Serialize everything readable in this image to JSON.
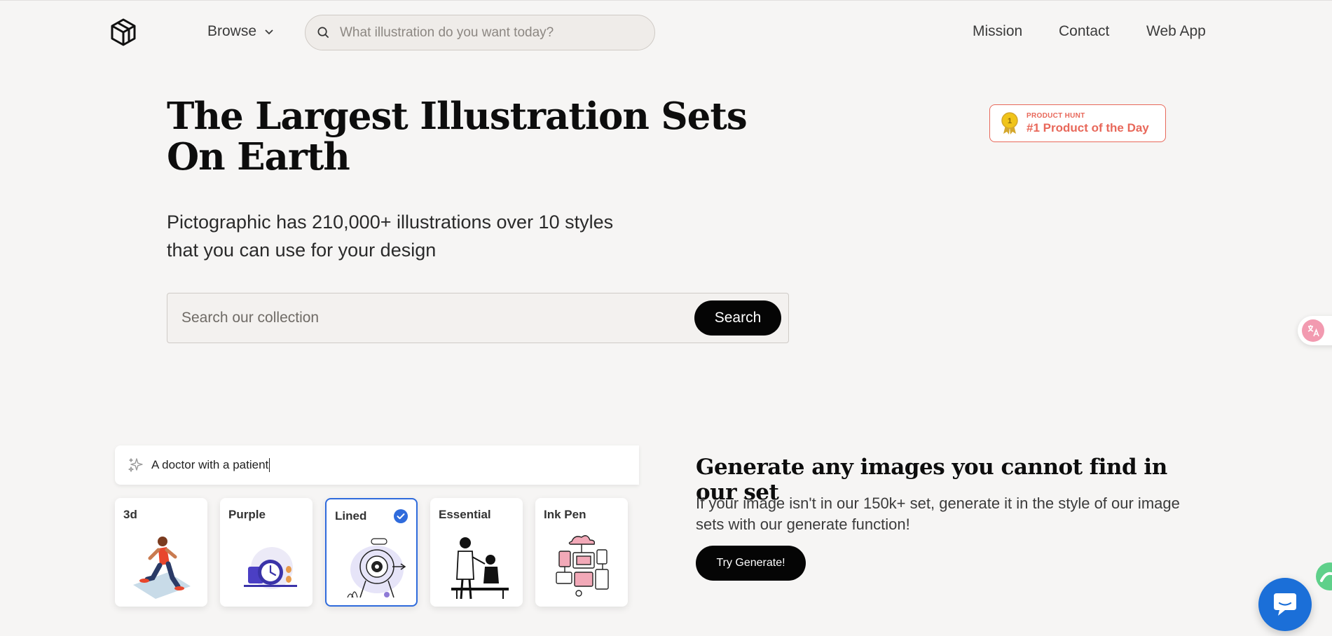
{
  "header": {
    "browse_label": "Browse",
    "search_placeholder": "What illustration do you want today?",
    "nav": [
      "Mission",
      "Contact",
      "Web App"
    ]
  },
  "hero": {
    "title": "The Largest Illustration Sets On Earth",
    "subtitle_line1": "Pictographic has 210,000+ illustrations over 10 styles",
    "subtitle_line2": "that you can use for your design",
    "search_placeholder": "Search our collection",
    "search_button": "Search"
  },
  "product_hunt": {
    "small_label": "PRODUCT HUNT",
    "title": "#1 Product of the Day",
    "medal_number": "1",
    "color": "#e8685a"
  },
  "generator": {
    "prompt": "A doctor with a patient",
    "styles": [
      {
        "label": "3d",
        "selected": false
      },
      {
        "label": "Purple",
        "selected": false
      },
      {
        "label": "Lined",
        "selected": true
      },
      {
        "label": "Essential",
        "selected": false
      },
      {
        "label": "Ink Pen",
        "selected": false
      }
    ],
    "title": "Generate any images you cannot find in our set",
    "description": "If your image isn't in our 150k+ set, generate it in the style of our image sets with our generate function!",
    "button": "Try Generate!"
  },
  "icons": {
    "logo": "cube-logo-icon",
    "search": "search-icon",
    "chevron": "chevron-down-icon",
    "sparkle": "sparkle-icon",
    "check": "check-circle-icon",
    "translate": "translate-icon",
    "chat": "chat-icon"
  },
  "colors": {
    "accent_blue": "#2f6bdc",
    "chat_blue": "#1b6fd8",
    "button_black": "#050505",
    "background": "#f6f5f4"
  }
}
